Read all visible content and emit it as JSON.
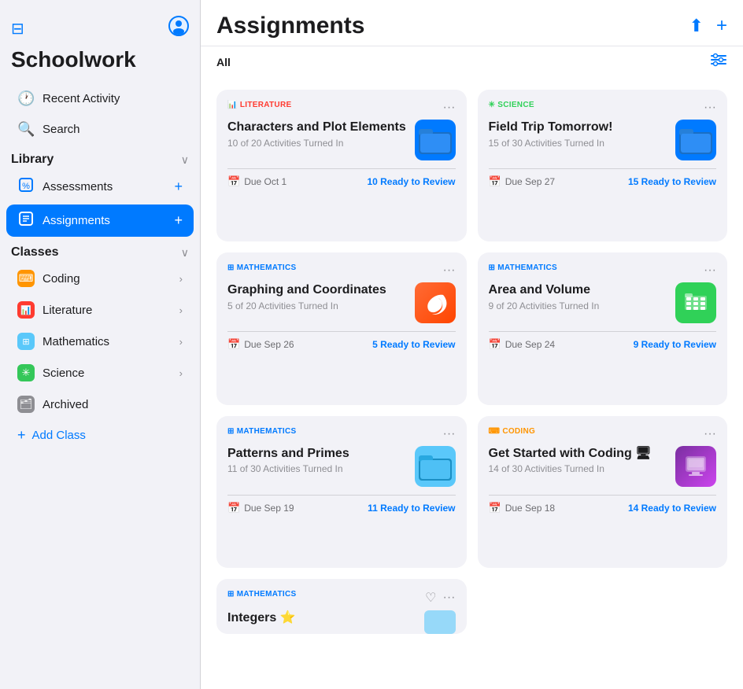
{
  "sidebar": {
    "toggle_icon": "⊟",
    "user_icon": "👤",
    "app_title": "Schoolwork",
    "nav": [
      {
        "id": "recent-activity",
        "icon": "🕐",
        "label": "Recent Activity"
      },
      {
        "id": "search",
        "icon": "🔍",
        "label": "Search"
      }
    ],
    "library_label": "Library",
    "library_items": [
      {
        "id": "assessments",
        "icon": "📊",
        "label": "Assessments",
        "icon_color": "blue"
      },
      {
        "id": "assignments",
        "icon": "📋",
        "label": "Assignments",
        "active": true,
        "icon_color": "blue"
      }
    ],
    "classes_label": "Classes",
    "classes": [
      {
        "id": "coding",
        "label": "Coding",
        "color": "orange",
        "symbol": "⌨"
      },
      {
        "id": "literature",
        "label": "Literature",
        "color": "red",
        "symbol": "📊"
      },
      {
        "id": "mathematics",
        "label": "Mathematics",
        "color": "teal",
        "symbol": "⊞"
      },
      {
        "id": "science",
        "label": "Science",
        "color": "green",
        "symbol": "✳"
      },
      {
        "id": "archived",
        "label": "Archived",
        "color": "gray",
        "symbol": "🗂"
      }
    ],
    "add_class_label": "Add Class"
  },
  "main": {
    "title": "Assignments",
    "filter_label": "All",
    "header_actions": {
      "share_icon": "⬆",
      "add_icon": "+"
    },
    "filter_icon": "⊟",
    "cards": [
      {
        "id": "card-1",
        "subject": "LITERATURE",
        "subject_class": "literature",
        "subject_icon": "📊",
        "title": "Characters and Plot Elements",
        "subtitle": "10 of 20 Activities Turned In",
        "thumbnail": "blue-folder",
        "due": "Due Oct 1",
        "review": "10 Ready to Review",
        "thumbnail_emoji": "📁"
      },
      {
        "id": "card-2",
        "subject": "SCIENCE",
        "subject_class": "science",
        "subject_icon": "✳",
        "title": "Field Trip Tomorrow!",
        "subtitle": "15 of 30 Activities Turned In",
        "thumbnail": "blue-folder",
        "due": "Due Sep 27",
        "review": "15 Ready to Review",
        "thumbnail_emoji": "📁"
      },
      {
        "id": "card-3",
        "subject": "MATHEMATICS",
        "subject_class": "mathematics",
        "subject_icon": "⊞",
        "title": "Graphing and Coordinates",
        "subtitle": "5 of 20 Activities Turned In",
        "thumbnail": "swift",
        "due": "Due Sep 26",
        "review": "5 Ready to Review",
        "thumbnail_emoji": "🐦"
      },
      {
        "id": "card-4",
        "subject": "MATHEMATICS",
        "subject_class": "mathematics",
        "subject_icon": "⊞",
        "title": "Area and Volume",
        "subtitle": "9 of 20 Activities Turned In",
        "thumbnail": "numbers",
        "due": "Due Sep 24",
        "review": "9 Ready to Review",
        "thumbnail_emoji": "📊"
      },
      {
        "id": "card-5",
        "subject": "MATHEMATICS",
        "subject_class": "mathematics",
        "subject_icon": "⊞",
        "title": "Patterns and Primes",
        "subtitle": "11 of 30 Activities Turned In",
        "thumbnail": "blue-folder2",
        "due": "Due Sep 19",
        "review": "11 Ready to Review",
        "thumbnail_emoji": "📁"
      },
      {
        "id": "card-6",
        "subject": "CODING",
        "subject_class": "coding",
        "subject_icon": "⌨",
        "title": "Get Started with Coding 🖥",
        "subtitle": "14 of 30 Activities Turned In",
        "thumbnail": "keynote",
        "due": "Due Sep 18",
        "review": "14 Ready to Review",
        "thumbnail_emoji": "🎞"
      },
      {
        "id": "card-7",
        "subject": "MATHEMATICS",
        "subject_class": "mathematics",
        "subject_icon": "⊞",
        "title": "Integers ⭐",
        "subtitle": "",
        "thumbnail": "blue-folder",
        "due": "",
        "review": "",
        "partial": true,
        "thumbnail_emoji": "📁"
      }
    ]
  }
}
